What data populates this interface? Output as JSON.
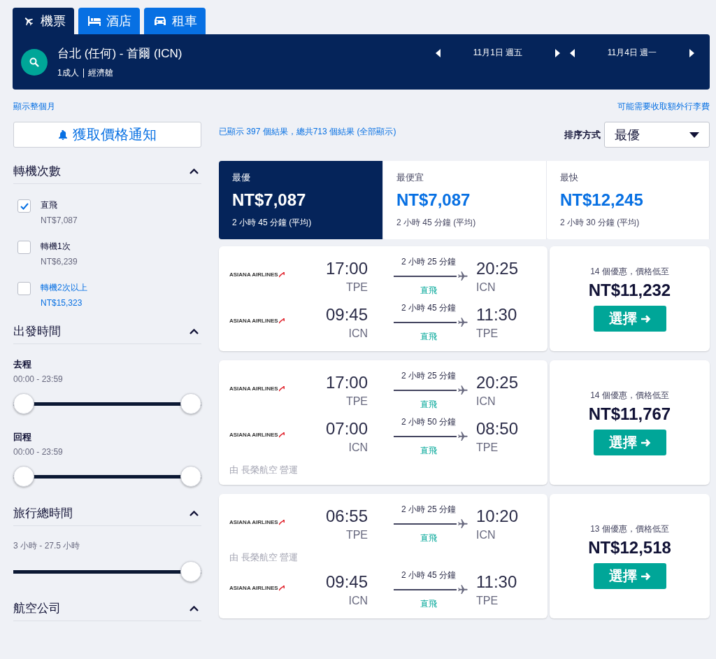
{
  "tabs": [
    {
      "kind": "flight",
      "label": "機票",
      "selected": true
    },
    {
      "kind": "hotel",
      "label": "酒店",
      "selected": false
    },
    {
      "kind": "car",
      "label": "租車",
      "selected": false
    }
  ],
  "search": {
    "route": "台北 (任何) - 首爾 (ICN)",
    "passengers": "1成人",
    "cabin": "經濟艙",
    "dates": [
      "11月1日 週五",
      "11月4日 週一"
    ]
  },
  "links": {
    "month": "顯示整個月",
    "baggage": "可能需要收取額外行李費"
  },
  "price_alert": "獲取價格通知",
  "results_text": "已顯示 397 個結果，總共713 個結果 (全部顯示)",
  "sort": {
    "label": "排序方式",
    "value": "最優"
  },
  "filters": [
    {
      "kind": "checkboxes",
      "title": "轉機次數",
      "expanded": true,
      "items": [
        {
          "label": "直飛",
          "price": "NT$7,087",
          "checked": true,
          "hovered": false
        },
        {
          "label": "轉機1次",
          "price": "NT$6,239",
          "checked": false,
          "hovered": false
        },
        {
          "label": "轉機2次以上",
          "price": "NT$15,323",
          "checked": false,
          "hovered": true
        }
      ]
    },
    {
      "kind": "sliders",
      "title": "出發時間",
      "expanded": true,
      "sliders": [
        {
          "label": "去程",
          "range": "00:00 - 23:59",
          "thumbs": [
            {
              "level": 0
            },
            {
              "level": 1
            }
          ]
        },
        {
          "label": "回程",
          "range": "00:00 - 23:59",
          "thumbs": [
            {
              "level": 0
            },
            {
              "level": 1
            }
          ]
        }
      ]
    },
    {
      "kind": "sliders",
      "title": "旅行總時間",
      "expanded": true,
      "sliders": [
        {
          "range": "3 小時 - 27.5 小時",
          "thumbs": [
            {
              "level": 1
            }
          ]
        }
      ]
    },
    {
      "kind": "checkboxes",
      "title": "航空公司",
      "expanded": true
    }
  ],
  "sort_tabs": [
    {
      "label": "最優",
      "price": "NT$7,087",
      "duration": "2 小時 45 分鐘 (平均)",
      "selected": true
    },
    {
      "label": "最便宜",
      "price": "NT$7,087",
      "duration": "2 小時 45 分鐘 (平均)",
      "selected": false
    },
    {
      "label": "最快",
      "price": "NT$12,245",
      "duration": "2 小時 30 分鐘 (平均)",
      "selected": false
    }
  ],
  "flights": [
    {
      "legs": [
        {
          "airline": "ASIANA AIRLINES",
          "depart": "17:00",
          "from": "TPE",
          "duration": "2 小時 25 分鐘",
          "stops": "直飛",
          "arrive": "20:25",
          "to": "ICN"
        },
        {
          "airline": "ASIANA AIRLINES",
          "depart": "09:45",
          "from": "ICN",
          "duration": "2 小時 45 分鐘",
          "stops": "直飛",
          "arrive": "11:30",
          "to": "TPE"
        }
      ],
      "deals": "14 個優惠，價格低至",
      "price": "NT$11,232",
      "button": "選擇"
    },
    {
      "legs": [
        {
          "airline": "ASIANA AIRLINES",
          "depart": "17:00",
          "from": "TPE",
          "duration": "2 小時 25 分鐘",
          "stops": "直飛",
          "arrive": "20:25",
          "to": "ICN"
        },
        {
          "airline": "ASIANA AIRLINES",
          "depart": "07:00",
          "from": "ICN",
          "duration": "2 小時 50 分鐘",
          "stops": "直飛",
          "arrive": "08:50",
          "to": "TPE",
          "operated_by": "由 長榮航空 營運"
        }
      ],
      "deals": "14 個優惠，價格低至",
      "price": "NT$11,767",
      "button": "選擇"
    },
    {
      "legs": [
        {
          "airline": "ASIANA AIRLINES",
          "depart": "06:55",
          "from": "TPE",
          "duration": "2 小時 25 分鐘",
          "stops": "直飛",
          "arrive": "10:20",
          "to": "ICN",
          "operated_by": "由 長榮航空 營運"
        },
        {
          "airline": "ASIANA AIRLINES",
          "depart": "09:45",
          "from": "ICN",
          "duration": "2 小時 45 分鐘",
          "stops": "直飛",
          "arrive": "11:30",
          "to": "TPE"
        }
      ],
      "deals": "13 個優惠，價格低至",
      "price": "NT$12,518",
      "button": "選擇"
    }
  ]
}
